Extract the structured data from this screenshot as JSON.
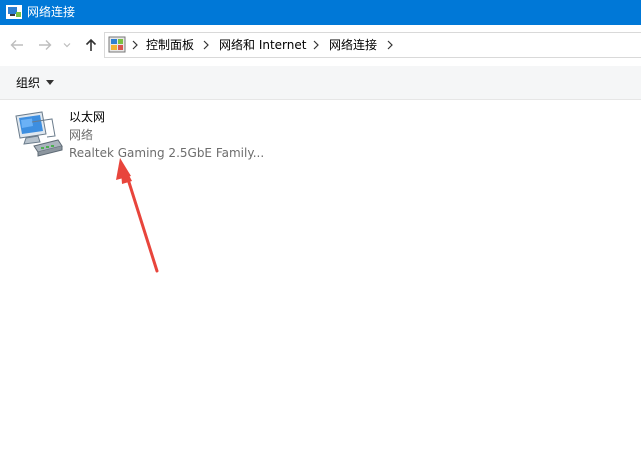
{
  "window": {
    "title": "网络连接"
  },
  "nav": {
    "back_icon": "arrow-left-icon",
    "forward_icon": "arrow-right-icon",
    "recent_icon": "chevron-down-icon",
    "up_icon": "arrow-up-icon"
  },
  "address": {
    "crumbs": [
      "控制面板",
      "网络和 Internet",
      "网络连接"
    ]
  },
  "toolbar": {
    "organize_label": "组织"
  },
  "connections": [
    {
      "name": "以太网",
      "status": "网络",
      "device": "Realtek Gaming 2.5GbE Family..."
    }
  ],
  "colors": {
    "titlebar": "#0078d7",
    "annotation_arrow": "#e8453c"
  }
}
